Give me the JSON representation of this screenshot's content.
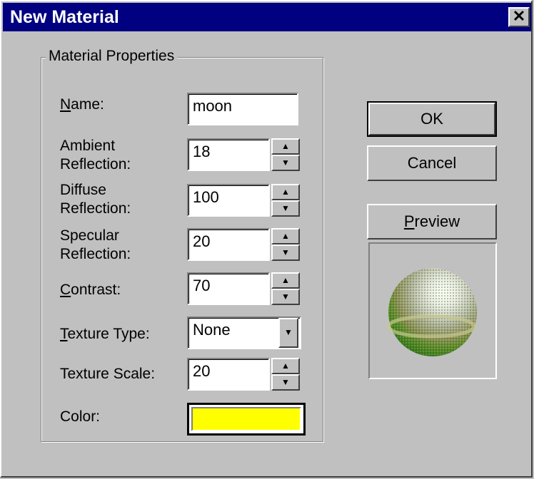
{
  "window": {
    "title": "New Material",
    "close_glyph": "✕"
  },
  "group": {
    "legend": "Material Properties"
  },
  "fields": {
    "name": {
      "label": "Name:",
      "value": "moon"
    },
    "ambient": {
      "label": "Ambient\nReflection:",
      "value": "18"
    },
    "diffuse": {
      "label": "Diffuse\nReflection:",
      "value": "100"
    },
    "specular": {
      "label": "Specular\nReflection:",
      "value": "20"
    },
    "contrast": {
      "label": "Contrast:",
      "value": "70"
    },
    "texture_type": {
      "label": "Texture Type:",
      "value": "None"
    },
    "texture_scale": {
      "label": "Texture Scale:",
      "value": "20"
    },
    "color": {
      "label": "Color:",
      "value": "#ffff00"
    }
  },
  "buttons": {
    "ok": "OK",
    "cancel": "Cancel",
    "preview": "Preview"
  },
  "icons": {
    "spin_up": "▲",
    "spin_down": "▼",
    "dropdown": "▼",
    "preview_sphere": "sphere-preview-icon"
  },
  "colors": {
    "titlebar": "#000080",
    "face": "#c0c0c0",
    "swatch": "#ffff00"
  }
}
